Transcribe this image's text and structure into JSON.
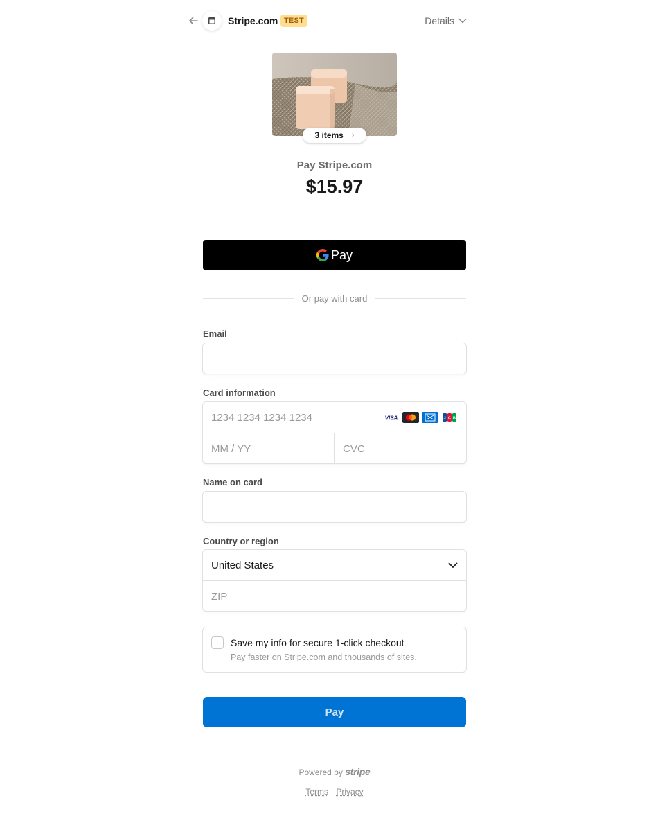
{
  "header": {
    "merchant_name": "Stripe.com",
    "test_badge": "TEST",
    "details_label": "Details"
  },
  "product": {
    "items_label": "3 items"
  },
  "summary": {
    "pay_to": "Pay Stripe.com",
    "amount": "$15.97"
  },
  "gpay": {
    "label": "Pay"
  },
  "divider_text": "Or pay with card",
  "email": {
    "label": "Email",
    "value": "",
    "placeholder": ""
  },
  "card": {
    "label": "Card information",
    "number_placeholder": "1234 1234 1234 1234",
    "expiry_placeholder": "MM / YY",
    "cvc_placeholder": "CVC",
    "brands": [
      "visa",
      "mastercard",
      "amex",
      "jcb"
    ]
  },
  "name_on_card": {
    "label": "Name on card",
    "value": "",
    "placeholder": ""
  },
  "country": {
    "label": "Country or region",
    "selected": "United States",
    "zip_placeholder": "ZIP"
  },
  "save_info": {
    "title": "Save my info for secure 1-click checkout",
    "subtitle": "Pay faster on Stripe.com and thousands of sites.",
    "checked": false
  },
  "pay_button": {
    "label": "Pay"
  },
  "footer": {
    "powered_by": "Powered by",
    "brand": "stripe",
    "terms": "Terms",
    "privacy": "Privacy"
  },
  "colors": {
    "pay_button": "#0074d4",
    "test_badge_bg": "#ffde92",
    "test_badge_text": "#a05d06"
  }
}
